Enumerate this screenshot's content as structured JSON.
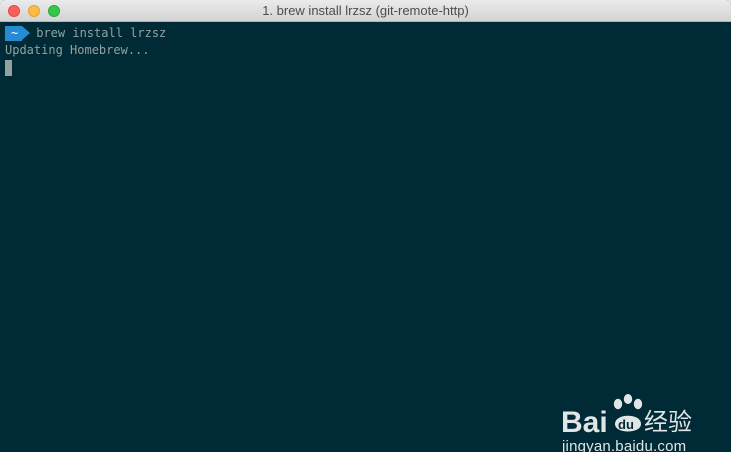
{
  "window": {
    "title": "1. brew install lrzsz (git-remote-http)"
  },
  "terminal": {
    "prompt_badge": "~",
    "command": "brew install lrzsz",
    "output_line": "Updating Homebrew..."
  },
  "watermark": {
    "logo_text_left": "Bai",
    "logo_text_du": "du",
    "logo_text_cn": "经验",
    "url": "jingyan.baidu.com"
  },
  "colors": {
    "terminal_background": "#002b36",
    "terminal_text": "#93a1a1",
    "prompt_badge": "#268bd2",
    "close_button": "#fc605c",
    "minimize_button": "#fdbc40",
    "maximize_button": "#34c84a"
  }
}
